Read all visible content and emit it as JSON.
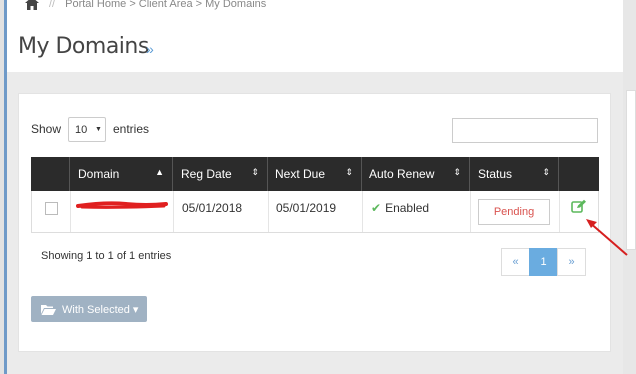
{
  "breadcrumb": {
    "sep": "//",
    "path": "Portal Home > Client Area > My Domains"
  },
  "page": {
    "title": "My Domains",
    "title_chevron": "»"
  },
  "table_controls": {
    "show_label": "Show",
    "page_length": "10",
    "entries_label": "entries",
    "search_value": ""
  },
  "table": {
    "columns": [
      "Domain",
      "Reg Date",
      "Next Due",
      "Auto Renew",
      "Status"
    ],
    "rows": [
      {
        "domain": "",
        "reg_date": "05/01/2018",
        "next_due": "05/01/2019",
        "auto_renew": "Enabled",
        "status": "Pending"
      }
    ]
  },
  "info": "Showing 1 to 1 of 1 entries",
  "pagination": {
    "prev": "«",
    "current": "1",
    "next": "»"
  },
  "bulk_action": {
    "label": "With Selected ▾"
  },
  "colors": {
    "header_bg": "#2b2b2b",
    "accent": "#5b9bd5",
    "status_pending": "#d9534f",
    "enabled_check": "#5cb85c",
    "annotation_arrow": "#d62020"
  }
}
